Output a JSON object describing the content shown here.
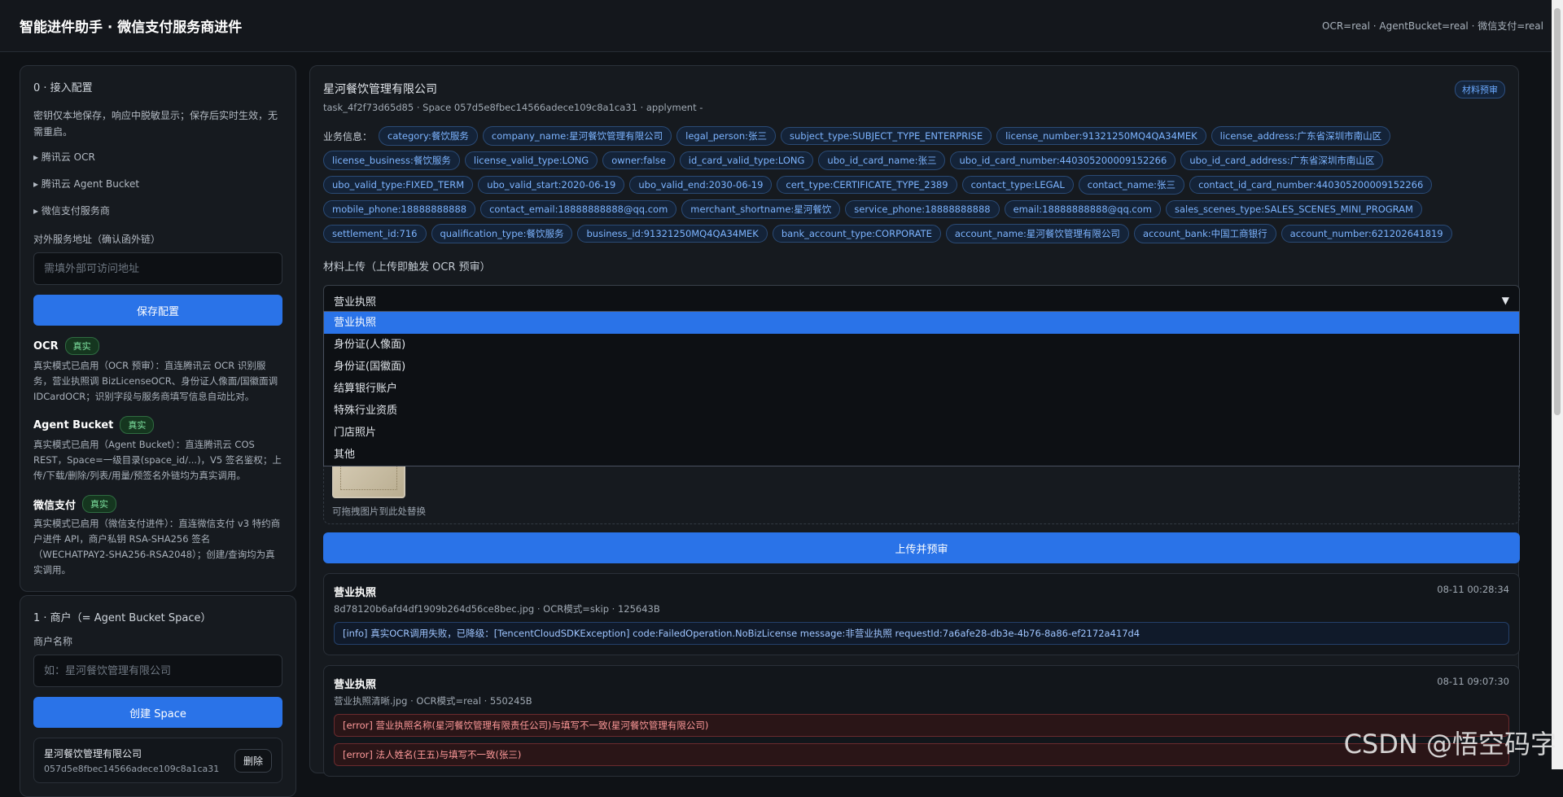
{
  "header": {
    "title": "智能进件助手 · 微信支付服务商进件",
    "status": "OCR=real · AgentBucket=real · 微信支付=real"
  },
  "sidebar": {
    "config": {
      "title": "0 · 接入配置",
      "note": "密钥仅本地保存，响应中脱敏显示；保存后实时生效，无需重启。",
      "sections": [
        "腾讯云 OCR",
        "腾讯云 Agent Bucket",
        "微信支付服务商"
      ],
      "url_label": "对外服务地址（确认函外链）",
      "url_placeholder": "需填外部可访问地址",
      "save_label": "保存配置"
    },
    "services": [
      {
        "name": "OCR",
        "badge": "真实",
        "desc": "真实模式已启用（OCR 预审）：直连腾讯云 OCR 识别服务，营业执照调 BizLicenseOCR、身份证人像面/国徽面调 IDCardOCR；识别字段与服务商填写信息自动比对。"
      },
      {
        "name": "Agent Bucket",
        "badge": "真实",
        "desc": "真实模式已启用（Agent Bucket）：直连腾讯云 COS REST，Space=一级目录(space_id/...)，V5 签名鉴权；上传/下载/删除/列表/用量/预签名外链均为真实调用。"
      },
      {
        "name": "微信支付",
        "badge": "真实",
        "desc": "真实模式已启用（微信支付进件）：直连微信支付 v3 特约商户进件 API，商户私钥 RSA-SHA256 签名（WECHATPAY2-SHA256-RSA2048）；创建/查询均为真实调用。"
      }
    ],
    "merchant": {
      "title": "1 · 商户（= Agent Bucket Space）",
      "name_label": "商户名称",
      "name_placeholder": "如：星河餐饮管理有限公司",
      "create_label": "创建 Space",
      "item_name": "星河餐饮管理有限公司",
      "item_space": "057d5e8fbec14566adece109c8a1ca31",
      "delete_label": "删除"
    }
  },
  "main": {
    "company": "星河餐饮管理有限公司",
    "task_meta": "task_4f2f73d65d85 · Space 057d5e8fbec14566adece109c8a1ca31 · applyment -",
    "badge": "材料预审",
    "tags_label": "业务信息：",
    "tags": [
      "category:餐饮服务",
      "company_name:星河餐饮管理有限公司",
      "legal_person:张三",
      "subject_type:SUBJECT_TYPE_ENTERPRISE",
      "license_number:91321250MQ4QA34MEK",
      "license_address:广东省深圳市南山区",
      "license_business:餐饮服务",
      "license_valid_type:LONG",
      "owner:false",
      "id_card_valid_type:LONG",
      "ubo_id_card_name:张三",
      "ubo_id_card_number:440305200009152266",
      "ubo_id_card_address:广东省深圳市南山区",
      "ubo_valid_type:FIXED_TERM",
      "ubo_valid_start:2020-06-19",
      "ubo_valid_end:2030-06-19",
      "cert_type:CERTIFICATE_TYPE_2389",
      "contact_type:LEGAL",
      "contact_name:张三",
      "contact_id_card_number:440305200009152266",
      "mobile_phone:18888888888",
      "contact_email:18888888888@qq.com",
      "merchant_shortname:星河餐饮",
      "service_phone:18888888888",
      "email:18888888888@qq.com",
      "sales_scenes_type:SALES_SCENES_MINI_PROGRAM",
      "settlement_id:716",
      "qualification_type:餐饮服务",
      "business_id:91321250MQ4QA34MEK",
      "bank_account_type:CORPORATE",
      "account_name:星河餐饮管理有限公司",
      "account_bank:中国工商银行",
      "account_number:621202641819"
    ],
    "upload_label": "材料上传（上传即触发 OCR 预审）",
    "select_value": "营业执照",
    "select_options": [
      "营业执照",
      "身份证(人像面)",
      "身份证(国徽面)",
      "结算银行账户",
      "特殊行业资质",
      "门店照片",
      "其他"
    ],
    "drop_hint": "可拖拽图片到此处替换",
    "upload_button": "上传并预审",
    "records": [
      {
        "title": "营业执照",
        "time": "08-11 00:28:34",
        "meta": "8d78120b6afd4df1909b264d56ce8bec.jpg · OCR模式=skip · 125643B",
        "logs": [
          {
            "level": "info",
            "text": "[info] 真实OCR调用失败，已降级：[TencentCloudSDKException] code:FailedOperation.NoBizLicense message:非营业执照 requestId:7a6afe28-db3e-4b76-8a86-ef2172a417d4"
          }
        ]
      },
      {
        "title": "营业执照",
        "time": "08-11 09:07:30",
        "meta": "营业执照清晰.jpg · OCR模式=real · 550245B",
        "logs": [
          {
            "level": "error",
            "text": "[error] 营业执照名称(星河餐饮管理有限责任公司)与填写不一致(星河餐饮管理有限公司)"
          },
          {
            "level": "error",
            "text": "[error] 法人姓名(王五)与填写不一致(张三)"
          }
        ]
      }
    ]
  },
  "watermark": "CSDN @悟空码字"
}
